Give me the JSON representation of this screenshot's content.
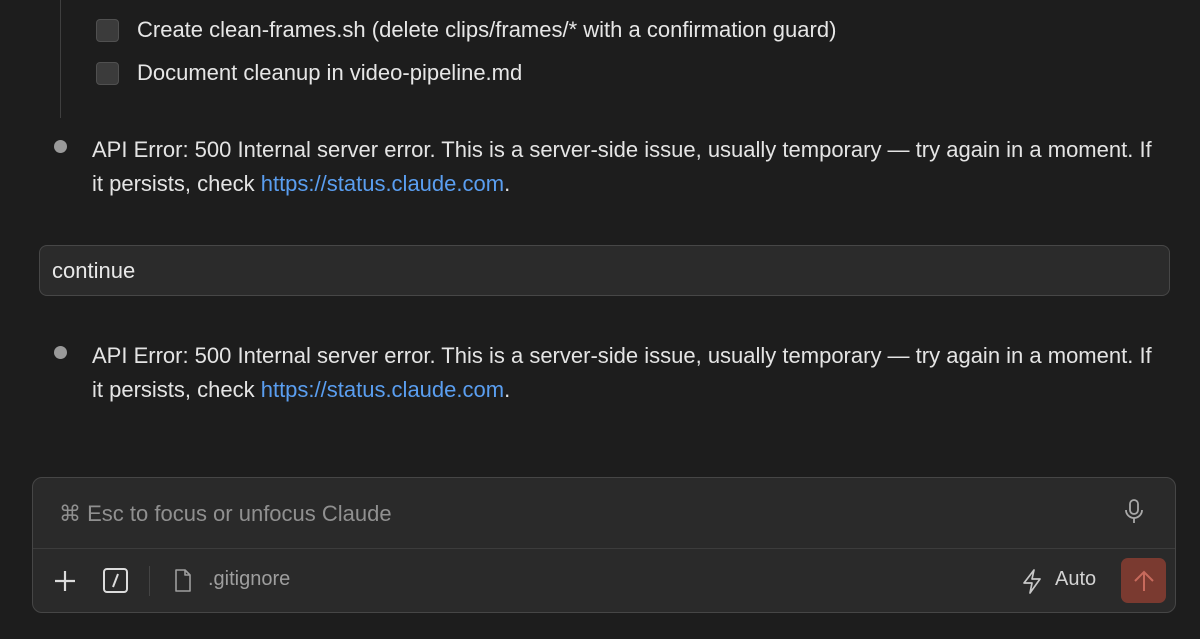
{
  "checklist": [
    {
      "label": "Create clean-frames.sh (delete clips/frames/* with a confirmation guard)",
      "checked": false
    },
    {
      "label": "Document cleanup in video-pipeline.md",
      "checked": false
    }
  ],
  "messages": [
    {
      "text": "API Error: 500 Internal server error. This is a server-side issue, usually temporary — try again in a moment. If it persists, check ",
      "link": "https://status.claude.com",
      "suffix": "."
    },
    {
      "text": "API Error: 500 Internal server error. This is a server-side issue, usually temporary — try again in a moment. If it persists, check ",
      "link": "https://status.claude.com",
      "suffix": "."
    }
  ],
  "user_message": "continue",
  "composer": {
    "placeholder": "⌘ Esc to focus or unfocus Claude",
    "attached_file": ".gitignore",
    "mode_label": "Auto",
    "icons": [
      "mic-icon",
      "plus-icon",
      "slash-command-icon",
      "file-icon",
      "bolt-icon",
      "arrow-up-icon"
    ]
  },
  "colors": {
    "background": "#1d1d1d",
    "link": "#5a9ef0",
    "send_button": "#7a3a30"
  }
}
